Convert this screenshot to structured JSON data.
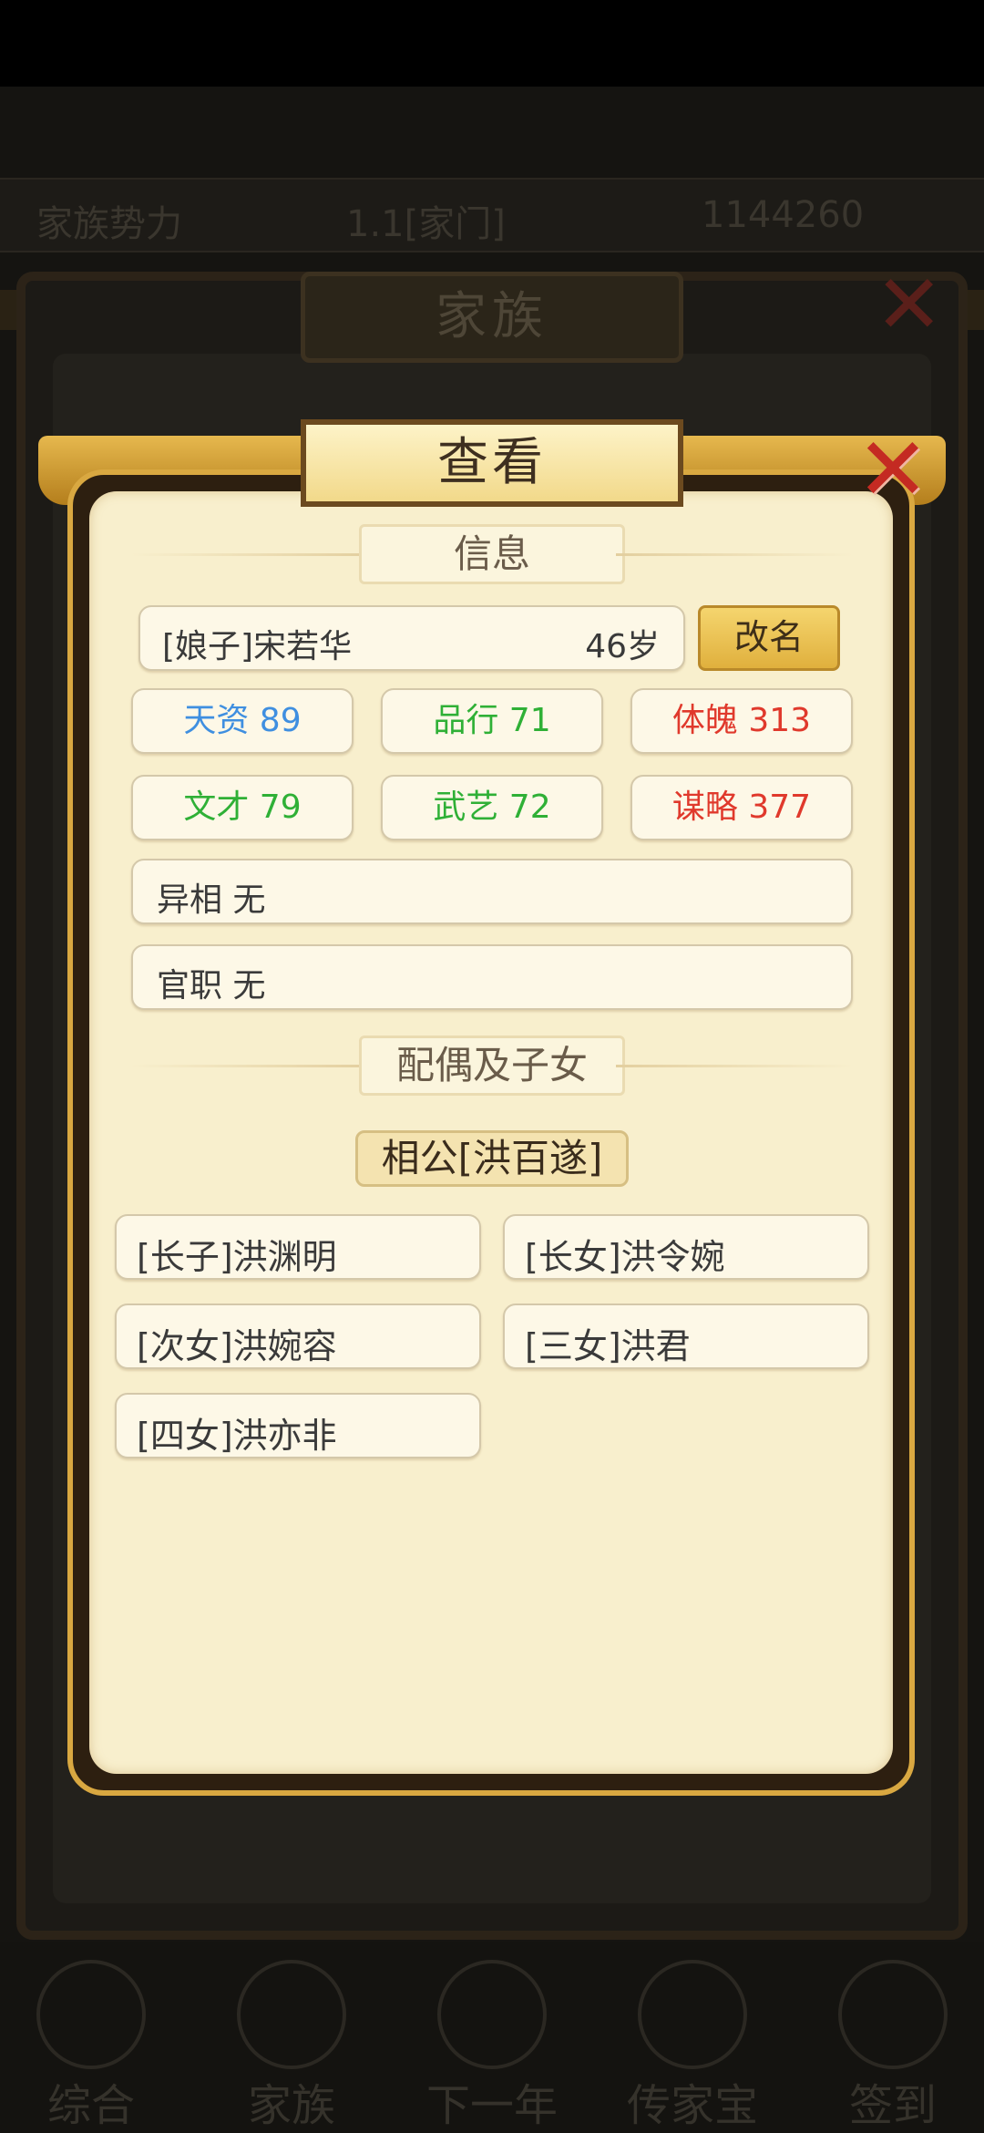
{
  "background": {
    "top_bar": {
      "left": "家族势力",
      "mid": "1.1[家门]",
      "right": "1144260"
    },
    "family_title": "家族",
    "nav": [
      "综合",
      "家族",
      "下一年",
      "传家宝",
      "签到"
    ]
  },
  "dialog": {
    "title": "查看",
    "info_header": "信息",
    "person": {
      "name": "[娘子]宋若华",
      "age": "46岁"
    },
    "rename_label": "改名",
    "stats": [
      {
        "label": "天资 89",
        "color": "#3f8fe0"
      },
      {
        "label": "品行 71",
        "color": "#2fb036"
      },
      {
        "label": "体魄 313",
        "color": "#e0392c"
      },
      {
        "label": "文才 79",
        "color": "#2fb036"
      },
      {
        "label": "武艺 72",
        "color": "#2fb036"
      },
      {
        "label": "谋略 377",
        "color": "#e0392c"
      }
    ],
    "trait": "异相 无",
    "office": "官职 无",
    "family_header": "配偶及子女",
    "spouse": "相公[洪百遂]",
    "children": [
      "[长子]洪渊明",
      "[长女]洪令婉",
      "[次女]洪婉容",
      "[三女]洪君",
      "[四女]洪亦非"
    ]
  }
}
